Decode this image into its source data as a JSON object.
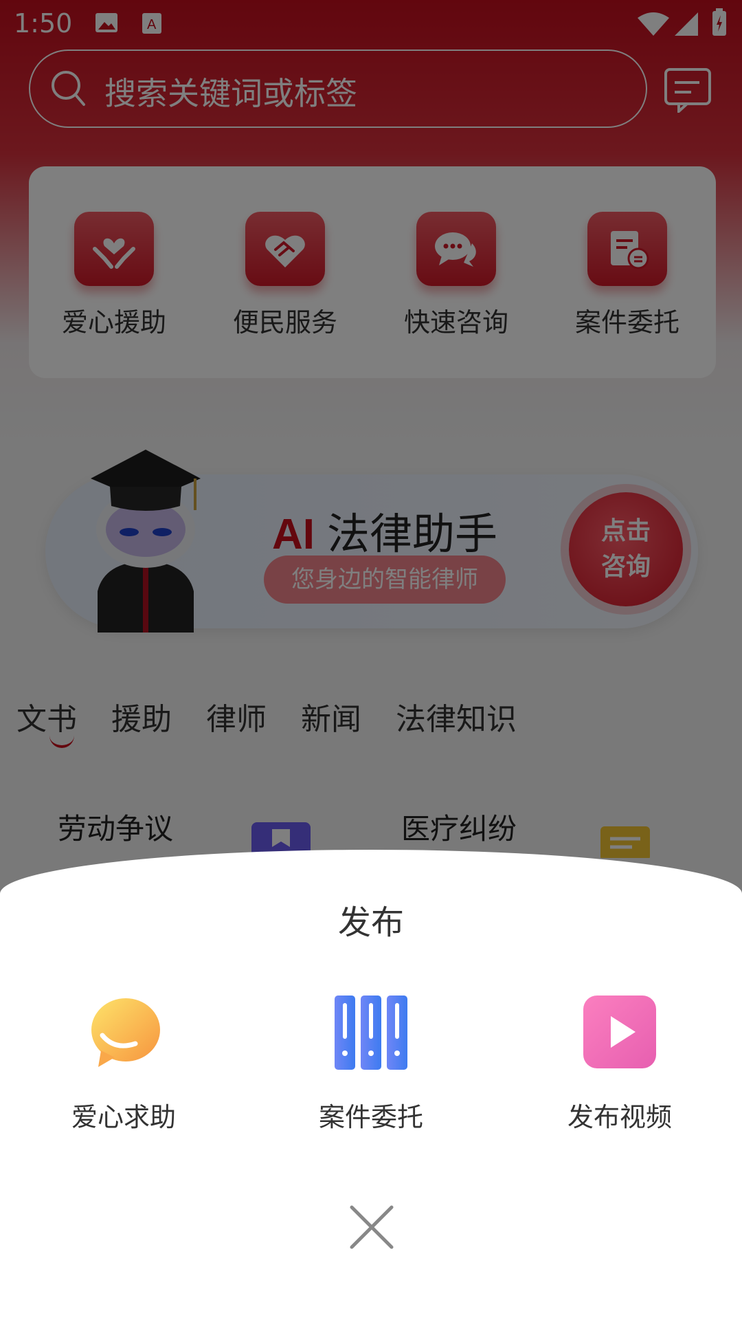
{
  "status_bar": {
    "time": "1:50"
  },
  "search": {
    "placeholder": "搜索关键词或标签"
  },
  "quick_actions": [
    {
      "label": "爱心援助",
      "icon": "heart-hands-icon"
    },
    {
      "label": "便民服务",
      "icon": "handshake-heart-icon"
    },
    {
      "label": "快速咨询",
      "icon": "chat-bubbles-icon"
    },
    {
      "label": "案件委托",
      "icon": "document-icon"
    }
  ],
  "ai_banner": {
    "ai": "AI",
    "title": "法律助手",
    "subtitle": "您身边的智能律师",
    "button_line1": "点击",
    "button_line2": "咨询"
  },
  "tabs": [
    "文书",
    "援助",
    "律师",
    "新闻",
    "法律知识"
  ],
  "categories": [
    "劳动争议",
    "医疗纠纷"
  ],
  "publish_sheet": {
    "title": "发布",
    "actions": [
      {
        "label": "爱心求助",
        "icon": "chat-bubble-icon"
      },
      {
        "label": "案件委托",
        "icon": "folders-icon"
      },
      {
        "label": "发布视频",
        "icon": "play-icon"
      }
    ]
  },
  "colors": {
    "brand_red": "#c80e1d",
    "accent_pink": "#f3858c"
  }
}
